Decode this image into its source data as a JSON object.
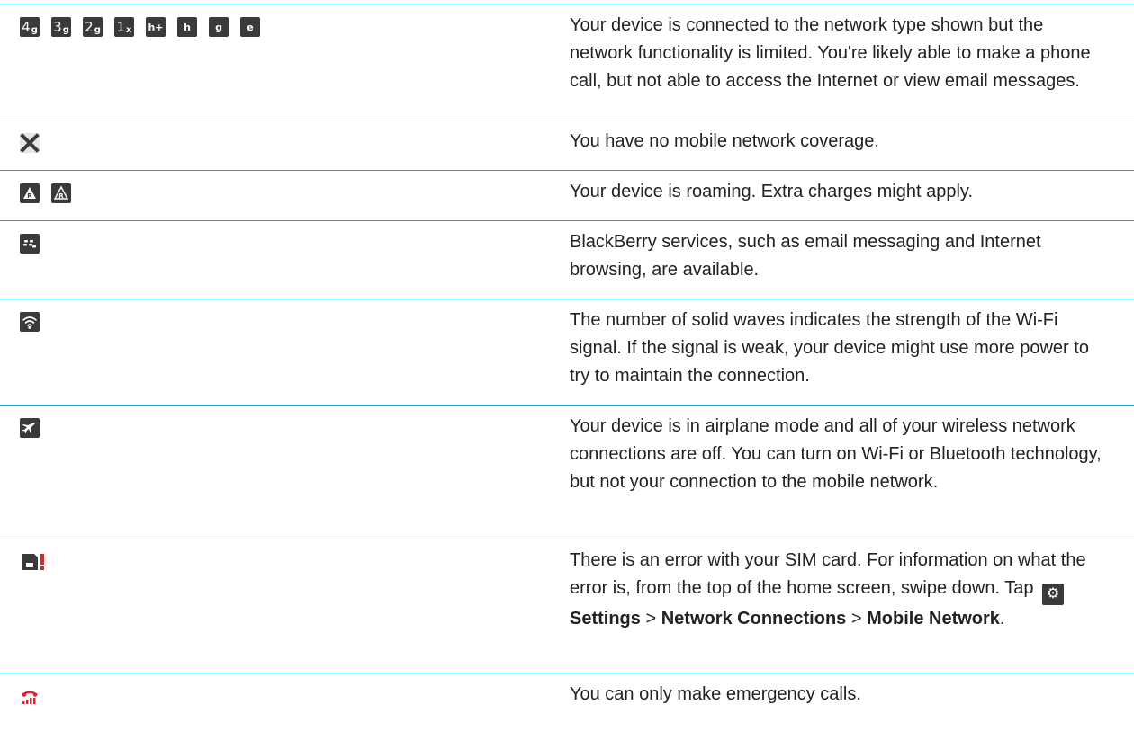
{
  "rows": [
    {
      "icons": [
        {
          "name": "network-4g-icon",
          "main": "4",
          "sub": "g"
        },
        {
          "name": "network-3g-icon",
          "main": "3",
          "sub": "g"
        },
        {
          "name": "network-2g-icon",
          "main": "2",
          "sub": "g"
        },
        {
          "name": "network-1x-icon",
          "main": "1",
          "sub": "x"
        },
        {
          "name": "network-h-plus-icon",
          "label": "h+"
        },
        {
          "name": "network-h-icon",
          "label": "h"
        },
        {
          "name": "network-g-icon",
          "label": "g"
        },
        {
          "name": "network-e-icon",
          "label": "e"
        }
      ],
      "text": "Your device is connected to the network type shown but the network functionality is limited. You're likely able to make a phone call, but not able to access the Internet or view email messages."
    },
    {
      "icons": [
        {
          "name": "no-coverage-x-icon"
        }
      ],
      "text": "You have no mobile network coverage."
    },
    {
      "icons": [
        {
          "name": "roaming-icon"
        },
        {
          "name": "roaming-outline-icon"
        }
      ],
      "text": "Your device is roaming. Extra charges might apply."
    },
    {
      "icons": [
        {
          "name": "blackberry-services-icon"
        }
      ],
      "text": "BlackBerry services, such as email messaging and Internet browsing, are available."
    },
    {
      "icons": [
        {
          "name": "wifi-signal-icon"
        }
      ],
      "text": "The number of solid waves indicates the strength of the Wi-Fi signal. If the signal is weak, your device might use more power to try to maintain the connection."
    },
    {
      "icons": [
        {
          "name": "airplane-mode-icon"
        }
      ],
      "text": "Your device is in airplane mode and all of your wireless network connections are off. You can turn on Wi-Fi or Bluetooth technology, but not your connection to the mobile network."
    },
    {
      "icons": [
        {
          "name": "sim-error-icon"
        }
      ],
      "text_pre": "There is an error with your SIM card. For information on what the error is, from the top of the home screen, swipe down. Tap",
      "settings_label": "Settings",
      "sep": ">",
      "network_connections_label": "Network Connections",
      "mobile_network_label": "Mobile Network",
      "text_end": "."
    },
    {
      "icons": [
        {
          "name": "emergency-calls-only-icon"
        }
      ],
      "text": "You can only make emergency calls."
    }
  ],
  "colors": {
    "rule": "#1aa3d9",
    "icon_bg": "#3a3a3a",
    "alert_red": "#e0232a"
  }
}
